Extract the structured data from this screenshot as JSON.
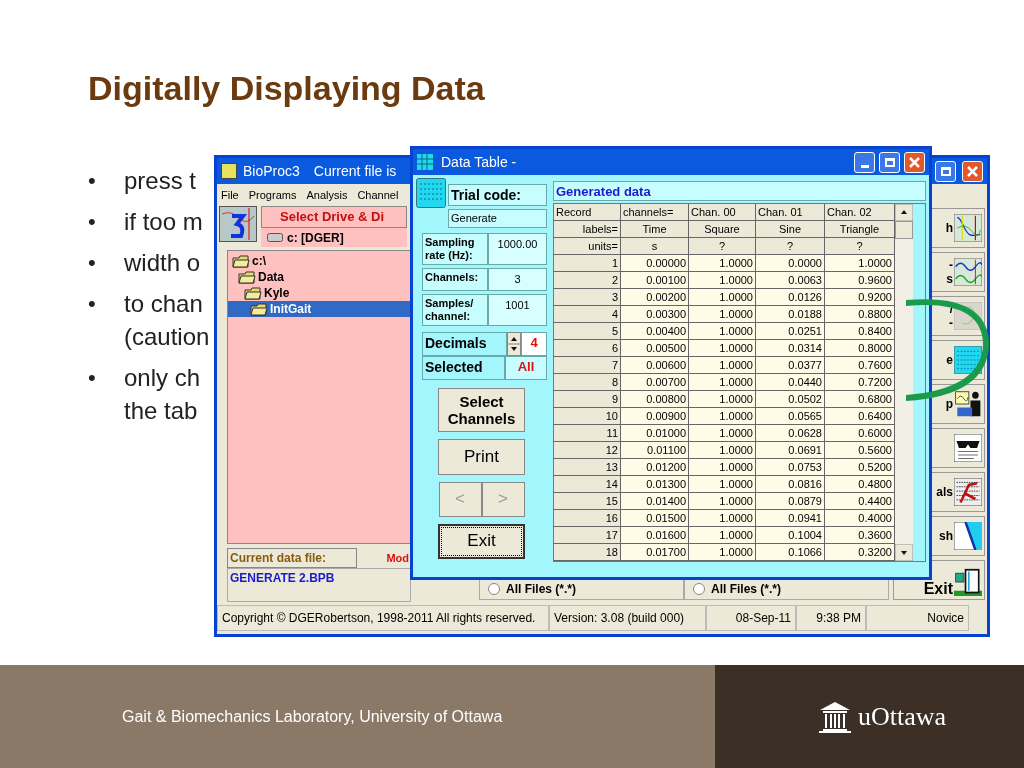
{
  "slide": {
    "title": "Digitally Displaying Data",
    "bullets": [
      {
        "marker": "•",
        "lines": [
          "press t"
        ]
      },
      {
        "marker": "•",
        "lines": [
          "if too m"
        ]
      },
      {
        "marker": "•",
        "lines": [
          "width o"
        ]
      },
      {
        "marker": "•",
        "lines": [
          "to chan",
          "(caution"
        ]
      },
      {
        "marker": "•",
        "lines": [
          "only ch",
          "the tab"
        ]
      }
    ],
    "footer": "Gait & Biomechanics Laboratory, University of Ottawa",
    "logo": "uOttawa"
  },
  "main_window": {
    "title": "BioProc3",
    "title_extra": "Current file is",
    "menu": [
      "File",
      "Programs",
      "Analysis",
      "Channel"
    ],
    "drive_heading": "Select Drive & Di",
    "drive": "c: [DGER]",
    "folders": [
      {
        "label": "c:\\",
        "selected": false,
        "children": [
          {
            "label": "Data",
            "selected": false,
            "children": [
              {
                "label": "Kyle",
                "selected": false,
                "children": [
                  {
                    "label": "InitGait",
                    "selected": true
                  }
                ]
              }
            ]
          }
        ]
      }
    ],
    "current_file_label": "Current data file:",
    "mode": "Mod",
    "current_file": "GENERATE 2.BPB",
    "filters": [
      {
        "label": "All Files (*.*)",
        "selected": false
      },
      {
        "label": "All Files (*.*)",
        "selected": false
      }
    ],
    "side_buttons": [
      {
        "lines": [
          "h"
        ],
        "kind": "graph",
        "disabled": false
      },
      {
        "lines": [
          "-",
          "s"
        ],
        "kind": "waves",
        "disabled": false
      },
      {
        "lines": [
          "/",
          "-"
        ],
        "kind": "blank",
        "disabled": true
      },
      {
        "lines": [
          "e"
        ],
        "kind": "table",
        "disabled": false
      },
      {
        "lines": [
          "p"
        ],
        "kind": "person",
        "disabled": false
      },
      {
        "kind": "glasses",
        "disabled": false
      },
      {
        "lines": [
          "als"
        ],
        "kind": "book",
        "disabled": false
      },
      {
        "lines": [
          "sh"
        ],
        "kind": "flash",
        "disabled": false
      },
      {
        "lines": [
          "Exit"
        ],
        "kind": "door",
        "disabled": false
      }
    ],
    "status_bar": [
      "Copyright © DGERobertson, 1998-2011  All rights reserved.",
      "Version: 3.08 (build 000)",
      "08-Sep-11",
      "9:38 PM",
      "Novice"
    ]
  },
  "data_table": {
    "title": "Data Table -",
    "trial_code_label": "Trial code:",
    "trial_code": "Generate",
    "fields": [
      {
        "label": "Sampling rate (Hz):",
        "value": "1000.00"
      },
      {
        "label": "Channels:",
        "value": "3"
      },
      {
        "label": "Samples/ channel:",
        "value": "1001"
      }
    ],
    "decimals_label": "Decimals",
    "decimals": "4",
    "selected_label": "Selected",
    "selected_value": "All",
    "buttons": [
      {
        "label": "Select Channels",
        "disabled": false,
        "focused": false
      },
      {
        "label": "Print",
        "disabled": false,
        "focused": false
      },
      {
        "label": "<",
        "disabled": true,
        "focused": false
      },
      {
        "label": ">",
        "disabled": true,
        "focused": false
      },
      {
        "label": "Exit",
        "disabled": false,
        "focused": true
      }
    ],
    "table": {
      "title": "Generated data",
      "header_rows": [
        [
          "Record",
          "channels=",
          "Chan. 00",
          "Chan. 01",
          "Chan. 02"
        ],
        [
          "labels=",
          "Time",
          "Square",
          "Sine",
          "Triangle"
        ],
        [
          "units=",
          "s",
          "?",
          "?",
          "?"
        ]
      ],
      "rows": [
        [
          "1",
          "0.00000",
          "1.0000",
          "0.0000",
          "1.0000"
        ],
        [
          "2",
          "0.00100",
          "1.0000",
          "0.0063",
          "0.9600"
        ],
        [
          "3",
          "0.00200",
          "1.0000",
          "0.0126",
          "0.9200"
        ],
        [
          "4",
          "0.00300",
          "1.0000",
          "0.0188",
          "0.8800"
        ],
        [
          "5",
          "0.00400",
          "1.0000",
          "0.0251",
          "0.8400"
        ],
        [
          "6",
          "0.00500",
          "1.0000",
          "0.0314",
          "0.8000"
        ],
        [
          "7",
          "0.00600",
          "1.0000",
          "0.0377",
          "0.7600"
        ],
        [
          "8",
          "0.00700",
          "1.0000",
          "0.0440",
          "0.7200"
        ],
        [
          "9",
          "0.00800",
          "1.0000",
          "0.0502",
          "0.6800"
        ],
        [
          "10",
          "0.00900",
          "1.0000",
          "0.0565",
          "0.6400"
        ],
        [
          "11",
          "0.01000",
          "1.0000",
          "0.0628",
          "0.6000"
        ],
        [
          "12",
          "0.01100",
          "1.0000",
          "0.0691",
          "0.5600"
        ],
        [
          "13",
          "0.01200",
          "1.0000",
          "0.0753",
          "0.5200"
        ],
        [
          "14",
          "0.01300",
          "1.0000",
          "0.0816",
          "0.4800"
        ],
        [
          "15",
          "0.01400",
          "1.0000",
          "0.0879",
          "0.4400"
        ],
        [
          "16",
          "0.01500",
          "1.0000",
          "0.0941",
          "0.4000"
        ],
        [
          "17",
          "0.01600",
          "1.0000",
          "0.1004",
          "0.3600"
        ],
        [
          "18",
          "0.01700",
          "1.0000",
          "0.1066",
          "0.3200"
        ]
      ]
    }
  }
}
